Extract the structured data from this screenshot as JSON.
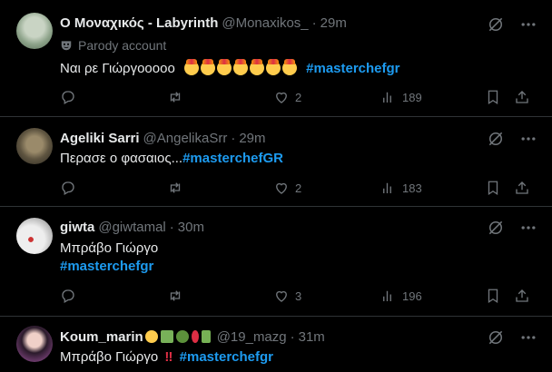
{
  "tweets": [
    {
      "name": "Ο Μοναχικός - Labyrinth",
      "handle": "@Monaxikos_",
      "time": "29m",
      "parody_label": "Parody account",
      "text": "Ναι ρε Γιώργοοοοο",
      "hashtag": "#masterchefgr",
      "likes": "2",
      "views": "189"
    },
    {
      "name": "Ageliki Sarri",
      "handle": "@AngelikaSrr",
      "time": "29m",
      "text": "Περασε ο φασαιος...",
      "hashtag": "#masterchefGR",
      "likes": "2",
      "views": "183"
    },
    {
      "name": "giwta",
      "handle": "@giwtamal",
      "time": "30m",
      "text": "Μπράβο Γιώργο",
      "hashtag": "#masterchefgr",
      "likes": "3",
      "views": "196"
    },
    {
      "name": "Koum_marin",
      "handle": "@19_mazg",
      "time": "31m",
      "text": "Μπράβο Γιώργο",
      "bang": "‼",
      "hashtag": "#masterchefgr"
    }
  ],
  "separator": "·",
  "colors": {
    "background": "#000000",
    "text": "#e7e9ea",
    "muted": "#71767b",
    "accent": "#1d9bf0",
    "divider": "#2f3336"
  },
  "icons": [
    "reply-icon",
    "retweet-icon",
    "like-icon",
    "views-icon",
    "bookmark-icon",
    "share-icon",
    "grok-icon",
    "more-icon",
    "parody-mask-icon"
  ]
}
